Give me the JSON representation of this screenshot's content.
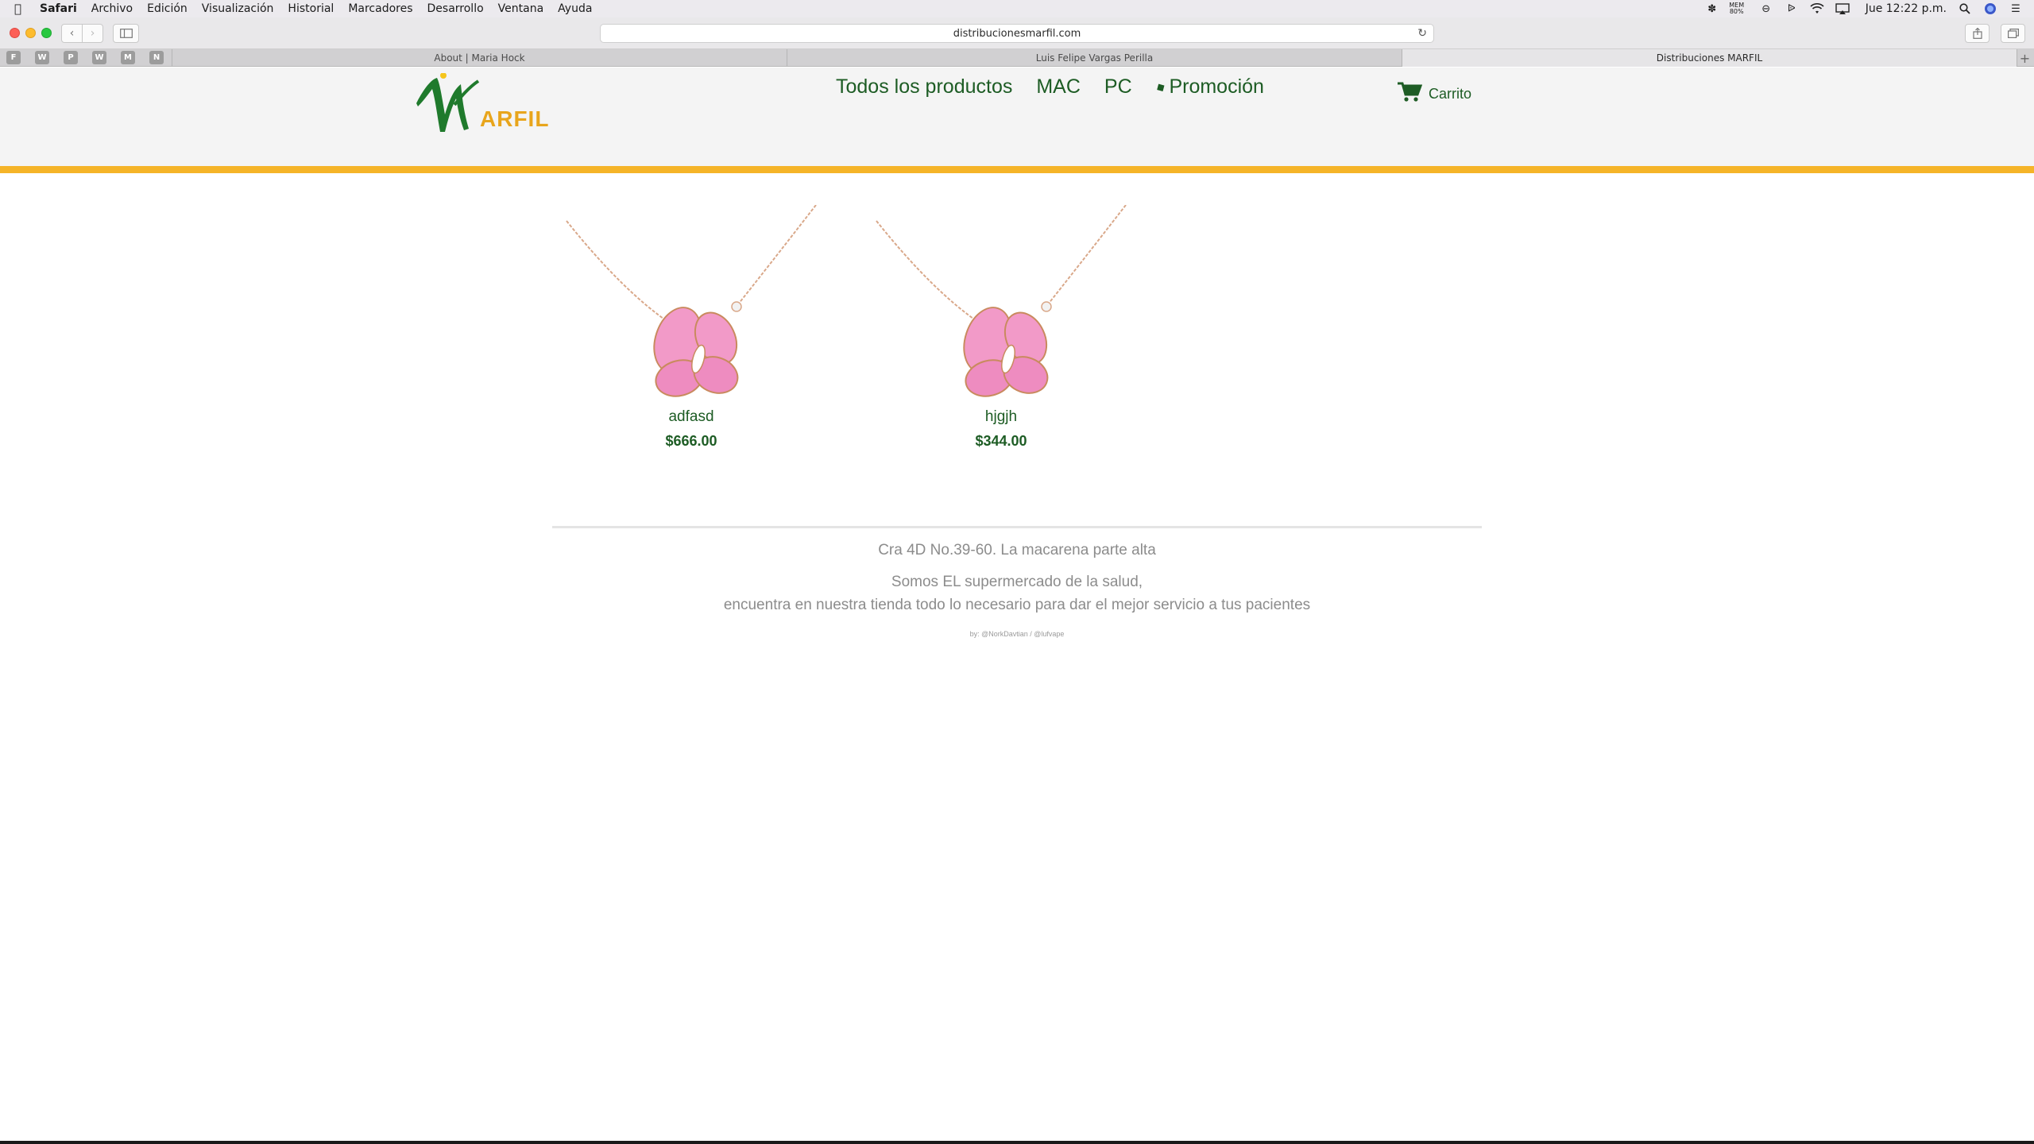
{
  "menubar": {
    "app": "Safari",
    "items": [
      "Archivo",
      "Edición",
      "Visualización",
      "Historial",
      "Marcadores",
      "Desarrollo",
      "Ventana",
      "Ayuda"
    ],
    "mem_label": "MEM",
    "mem_value": "80%",
    "clock": "Jue 12:22 p.m."
  },
  "browser": {
    "url": "distribucionesmarfil.com",
    "pinned_tabs": [
      "F",
      "W",
      "P",
      "W",
      "M",
      "N"
    ],
    "tabs": [
      {
        "title": "About | Maria Hock"
      },
      {
        "title": "Luis Felipe Vargas Perilla"
      },
      {
        "title": "Distribuciones MARFIL",
        "active": true
      }
    ]
  },
  "site": {
    "logo_text": "ARFIL",
    "brand_color": "#1d5c24",
    "accent_color": "#f5b428",
    "nav": [
      {
        "label": "Todos los productos"
      },
      {
        "label": "MAC"
      },
      {
        "label": "PC"
      },
      {
        "label": "Promoción",
        "icon": "tag-icon"
      }
    ],
    "cart_label": "Carrito"
  },
  "products": [
    {
      "name": "adfasd",
      "price": "$666.00"
    },
    {
      "name": "hjgjh",
      "price": "$344.00"
    }
  ],
  "footer": {
    "address": "Cra 4D No.39-60. La macarena parte alta",
    "slogan_line1": "Somos EL supermercado de la salud,",
    "slogan_line2": "encuentra en nuestra tienda todo lo necesario para dar el mejor servicio a tus pacientes",
    "credits": "by: @NorkDavtian / @lufvape"
  }
}
